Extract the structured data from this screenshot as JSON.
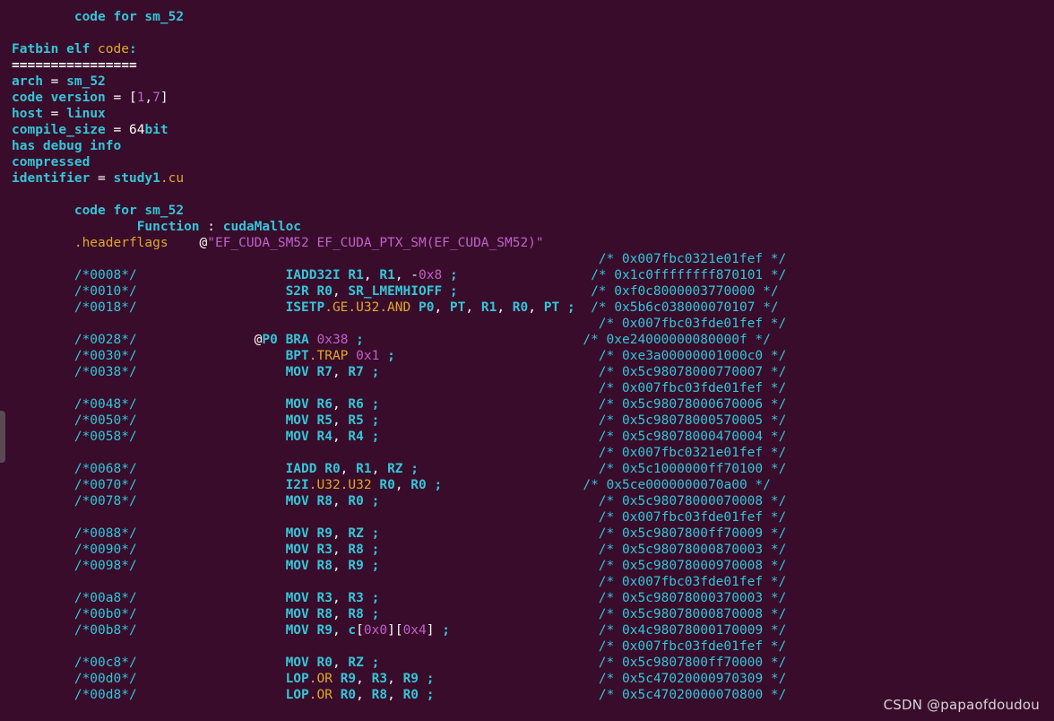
{
  "colors": {
    "background": "#380c2a",
    "keyword_cyan": "#34c6d8",
    "yellow": "#e0a829",
    "purple": "#c061cb",
    "white": "#ffffff"
  },
  "watermark": "CSDN @papaofdoudou",
  "terminal_lines": [
    [
      {
        "t": "        "
      },
      {
        "t": "code for sm_52",
        "c": "kw"
      }
    ],
    [],
    [
      {
        "t": "Fatbin elf ",
        "c": "kw"
      },
      {
        "t": "code",
        "c": "y"
      },
      {
        "t": ":",
        "c": "kw"
      }
    ],
    [
      {
        "t": "================",
        "c": "wb"
      }
    ],
    [
      {
        "t": "arch",
        "c": "kw"
      },
      {
        "t": " = "
      },
      {
        "t": "sm_52",
        "c": "kw"
      }
    ],
    [
      {
        "t": "code version",
        "c": "kw"
      },
      {
        "t": " = ["
      },
      {
        "t": "1",
        "c": "p"
      },
      {
        "t": ","
      },
      {
        "t": "7",
        "c": "p"
      },
      {
        "t": "]"
      }
    ],
    [
      {
        "t": "host",
        "c": "kw"
      },
      {
        "t": " = "
      },
      {
        "t": "linux",
        "c": "kw"
      }
    ],
    [
      {
        "t": "compile_size",
        "c": "kw"
      },
      {
        "t": " = "
      },
      {
        "t": "64"
      },
      {
        "t": "bit",
        "c": "kw"
      }
    ],
    [
      {
        "t": "has debug info",
        "c": "kw"
      }
    ],
    [
      {
        "t": "compressed",
        "c": "kw"
      }
    ],
    [
      {
        "t": "identifier",
        "c": "kw"
      },
      {
        "t": " = "
      },
      {
        "t": "study1",
        "c": "kw"
      },
      {
        "t": ".cu",
        "c": "y"
      }
    ],
    [],
    [
      {
        "t": "        "
      },
      {
        "t": "code for sm_52",
        "c": "kw"
      }
    ],
    [
      {
        "t": "                "
      },
      {
        "t": "Function",
        "c": "kw"
      },
      {
        "t": " : "
      },
      {
        "t": "cudaMalloc",
        "c": "kw"
      }
    ],
    [
      {
        "t": "        "
      },
      {
        "t": ".headerflags",
        "c": "y"
      },
      {
        "t": "    @"
      },
      {
        "t": "\"EF_CUDA_SM52 EF_CUDA_PTX_SM(EF_CUDA_SM52)\"",
        "c": "p"
      }
    ],
    [
      {
        "t": "                                                                           "
      },
      {
        "t": "/* 0x007fbc0321e01fef */",
        "c": "hex"
      }
    ],
    [
      {
        "t": "        "
      },
      {
        "t": "/*0008*/",
        "c": "cm"
      },
      {
        "t": "                   "
      },
      {
        "t": "IADD32I R1",
        "c": "kw"
      },
      {
        "t": ", "
      },
      {
        "t": "R1",
        "c": "kw"
      },
      {
        "t": ", -"
      },
      {
        "t": "0x8",
        "c": "p"
      },
      {
        "t": " ;",
        "c": "kw"
      },
      {
        "t": "                 "
      },
      {
        "t": "/* 0x1c0ffffffff870101 */",
        "c": "hex"
      }
    ],
    [
      {
        "t": "        "
      },
      {
        "t": "/*0010*/",
        "c": "cm"
      },
      {
        "t": "                   "
      },
      {
        "t": "S2R R0",
        "c": "kw"
      },
      {
        "t": ", "
      },
      {
        "t": "SR_LMEMHIOFF",
        "c": "kw"
      },
      {
        "t": " ;",
        "c": "kw"
      },
      {
        "t": "                 "
      },
      {
        "t": "/* 0xf0c8000003770000 */",
        "c": "hex"
      }
    ],
    [
      {
        "t": "        "
      },
      {
        "t": "/*0018*/",
        "c": "cm"
      },
      {
        "t": "                   "
      },
      {
        "t": "ISETP",
        "c": "kw"
      },
      {
        "t": ".GE.U32.AND",
        "c": "y"
      },
      {
        "t": " "
      },
      {
        "t": "P0",
        "c": "kw"
      },
      {
        "t": ", "
      },
      {
        "t": "PT",
        "c": "kw"
      },
      {
        "t": ", "
      },
      {
        "t": "R1",
        "c": "kw"
      },
      {
        "t": ", "
      },
      {
        "t": "R0",
        "c": "kw"
      },
      {
        "t": ", "
      },
      {
        "t": "PT",
        "c": "kw"
      },
      {
        "t": " ;",
        "c": "kw"
      },
      {
        "t": "  "
      },
      {
        "t": "/* 0x5b6c038000070107 */",
        "c": "hex"
      }
    ],
    [
      {
        "t": "                                                                           "
      },
      {
        "t": "/* 0x007fbc03fde01fef */",
        "c": "hex"
      }
    ],
    [
      {
        "t": "        "
      },
      {
        "t": "/*0028*/",
        "c": "cm"
      },
      {
        "t": "               @"
      },
      {
        "t": "P0",
        "c": "kw"
      },
      {
        "t": " "
      },
      {
        "t": "BRA",
        "c": "kw"
      },
      {
        "t": " "
      },
      {
        "t": "0x38",
        "c": "p"
      },
      {
        "t": " ;",
        "c": "kw"
      },
      {
        "t": "                            "
      },
      {
        "t": "/* 0xe24000000080000f */",
        "c": "hex"
      }
    ],
    [
      {
        "t": "        "
      },
      {
        "t": "/*0030*/",
        "c": "cm"
      },
      {
        "t": "                   "
      },
      {
        "t": "BPT",
        "c": "kw"
      },
      {
        "t": ".TRAP",
        "c": "y"
      },
      {
        "t": " "
      },
      {
        "t": "0x1",
        "c": "p"
      },
      {
        "t": " ;",
        "c": "kw"
      },
      {
        "t": "                          "
      },
      {
        "t": "/* 0xe3a00000001000c0 */",
        "c": "hex"
      }
    ],
    [
      {
        "t": "        "
      },
      {
        "t": "/*0038*/",
        "c": "cm"
      },
      {
        "t": "                   "
      },
      {
        "t": "MOV R7",
        "c": "kw"
      },
      {
        "t": ", "
      },
      {
        "t": "R7",
        "c": "kw"
      },
      {
        "t": " ;",
        "c": "kw"
      },
      {
        "t": "                            "
      },
      {
        "t": "/* 0x5c98078000770007 */",
        "c": "hex"
      }
    ],
    [
      {
        "t": "                                                                           "
      },
      {
        "t": "/* 0x007fbc03fde01fef */",
        "c": "hex"
      }
    ],
    [
      {
        "t": "        "
      },
      {
        "t": "/*0048*/",
        "c": "cm"
      },
      {
        "t": "                   "
      },
      {
        "t": "MOV R6",
        "c": "kw"
      },
      {
        "t": ", "
      },
      {
        "t": "R6",
        "c": "kw"
      },
      {
        "t": " ;",
        "c": "kw"
      },
      {
        "t": "                            "
      },
      {
        "t": "/* 0x5c98078000670006 */",
        "c": "hex"
      }
    ],
    [
      {
        "t": "        "
      },
      {
        "t": "/*0050*/",
        "c": "cm"
      },
      {
        "t": "                   "
      },
      {
        "t": "MOV R5",
        "c": "kw"
      },
      {
        "t": ", "
      },
      {
        "t": "R5",
        "c": "kw"
      },
      {
        "t": " ;",
        "c": "kw"
      },
      {
        "t": "                            "
      },
      {
        "t": "/* 0x5c98078000570005 */",
        "c": "hex"
      }
    ],
    [
      {
        "t": "        "
      },
      {
        "t": "/*0058*/",
        "c": "cm"
      },
      {
        "t": "                   "
      },
      {
        "t": "MOV R4",
        "c": "kw"
      },
      {
        "t": ", "
      },
      {
        "t": "R4",
        "c": "kw"
      },
      {
        "t": " ;",
        "c": "kw"
      },
      {
        "t": "                            "
      },
      {
        "t": "/* 0x5c98078000470004 */",
        "c": "hex"
      }
    ],
    [
      {
        "t": "                                                                           "
      },
      {
        "t": "/* 0x007fbc0321e01fef */",
        "c": "hex"
      }
    ],
    [
      {
        "t": "        "
      },
      {
        "t": "/*0068*/",
        "c": "cm"
      },
      {
        "t": "                   "
      },
      {
        "t": "IADD R0",
        "c": "kw"
      },
      {
        "t": ", "
      },
      {
        "t": "R1",
        "c": "kw"
      },
      {
        "t": ", "
      },
      {
        "t": "RZ",
        "c": "kw"
      },
      {
        "t": " ;",
        "c": "kw"
      },
      {
        "t": "                       "
      },
      {
        "t": "/* 0x5c1000000ff70100 */",
        "c": "hex"
      }
    ],
    [
      {
        "t": "        "
      },
      {
        "t": "/*0070*/",
        "c": "cm"
      },
      {
        "t": "                   "
      },
      {
        "t": "I2I",
        "c": "kw"
      },
      {
        "t": ".U32.U32",
        "c": "y"
      },
      {
        "t": " "
      },
      {
        "t": "R0",
        "c": "kw"
      },
      {
        "t": ", "
      },
      {
        "t": "R0",
        "c": "kw"
      },
      {
        "t": " ;",
        "c": "kw"
      },
      {
        "t": "                  "
      },
      {
        "t": "/* 0x5ce0000000070a00 */",
        "c": "hex"
      }
    ],
    [
      {
        "t": "        "
      },
      {
        "t": "/*0078*/",
        "c": "cm"
      },
      {
        "t": "                   "
      },
      {
        "t": "MOV R8",
        "c": "kw"
      },
      {
        "t": ", "
      },
      {
        "t": "R0",
        "c": "kw"
      },
      {
        "t": " ;",
        "c": "kw"
      },
      {
        "t": "                            "
      },
      {
        "t": "/* 0x5c98078000070008 */",
        "c": "hex"
      }
    ],
    [
      {
        "t": "                                                                           "
      },
      {
        "t": "/* 0x007fbc03fde01fef */",
        "c": "hex"
      }
    ],
    [
      {
        "t": "        "
      },
      {
        "t": "/*0088*/",
        "c": "cm"
      },
      {
        "t": "                   "
      },
      {
        "t": "MOV R9",
        "c": "kw"
      },
      {
        "t": ", "
      },
      {
        "t": "RZ",
        "c": "kw"
      },
      {
        "t": " ;",
        "c": "kw"
      },
      {
        "t": "                            "
      },
      {
        "t": "/* 0x5c9807800ff70009 */",
        "c": "hex"
      }
    ],
    [
      {
        "t": "        "
      },
      {
        "t": "/*0090*/",
        "c": "cm"
      },
      {
        "t": "                   "
      },
      {
        "t": "MOV R3",
        "c": "kw"
      },
      {
        "t": ", "
      },
      {
        "t": "R8",
        "c": "kw"
      },
      {
        "t": " ;",
        "c": "kw"
      },
      {
        "t": "                            "
      },
      {
        "t": "/* 0x5c98078000870003 */",
        "c": "hex"
      }
    ],
    [
      {
        "t": "        "
      },
      {
        "t": "/*0098*/",
        "c": "cm"
      },
      {
        "t": "                   "
      },
      {
        "t": "MOV R8",
        "c": "kw"
      },
      {
        "t": ", "
      },
      {
        "t": "R9",
        "c": "kw"
      },
      {
        "t": " ;",
        "c": "kw"
      },
      {
        "t": "                            "
      },
      {
        "t": "/* 0x5c98078000970008 */",
        "c": "hex"
      }
    ],
    [
      {
        "t": "                                                                           "
      },
      {
        "t": "/* 0x007fbc03fde01fef */",
        "c": "hex"
      }
    ],
    [
      {
        "t": "        "
      },
      {
        "t": "/*00a8*/",
        "c": "cm"
      },
      {
        "t": "                   "
      },
      {
        "t": "MOV R3",
        "c": "kw"
      },
      {
        "t": ", "
      },
      {
        "t": "R3",
        "c": "kw"
      },
      {
        "t": " ;",
        "c": "kw"
      },
      {
        "t": "                            "
      },
      {
        "t": "/* 0x5c98078000370003 */",
        "c": "hex"
      }
    ],
    [
      {
        "t": "        "
      },
      {
        "t": "/*00b0*/",
        "c": "cm"
      },
      {
        "t": "                   "
      },
      {
        "t": "MOV R8",
        "c": "kw"
      },
      {
        "t": ", "
      },
      {
        "t": "R8",
        "c": "kw"
      },
      {
        "t": " ;",
        "c": "kw"
      },
      {
        "t": "                            "
      },
      {
        "t": "/* 0x5c98078000870008 */",
        "c": "hex"
      }
    ],
    [
      {
        "t": "        "
      },
      {
        "t": "/*00b8*/",
        "c": "cm"
      },
      {
        "t": "                   "
      },
      {
        "t": "MOV R9",
        "c": "kw"
      },
      {
        "t": ", "
      },
      {
        "t": "c",
        "c": "kw"
      },
      {
        "t": "["
      },
      {
        "t": "0x0",
        "c": "p"
      },
      {
        "t": "]["
      },
      {
        "t": "0x4",
        "c": "p"
      },
      {
        "t": "]"
      },
      {
        "t": " ;",
        "c": "kw"
      },
      {
        "t": "                   "
      },
      {
        "t": "/* 0x4c98078000170009 */",
        "c": "hex"
      }
    ],
    [
      {
        "t": "                                                                           "
      },
      {
        "t": "/* 0x007fbc03fde01fef */",
        "c": "hex"
      }
    ],
    [
      {
        "t": "        "
      },
      {
        "t": "/*00c8*/",
        "c": "cm"
      },
      {
        "t": "                   "
      },
      {
        "t": "MOV R0",
        "c": "kw"
      },
      {
        "t": ", "
      },
      {
        "t": "RZ",
        "c": "kw"
      },
      {
        "t": " ;",
        "c": "kw"
      },
      {
        "t": "                            "
      },
      {
        "t": "/* 0x5c9807800ff70000 */",
        "c": "hex"
      }
    ],
    [
      {
        "t": "        "
      },
      {
        "t": "/*00d0*/",
        "c": "cm"
      },
      {
        "t": "                   "
      },
      {
        "t": "LOP",
        "c": "kw"
      },
      {
        "t": ".OR",
        "c": "y"
      },
      {
        "t": " "
      },
      {
        "t": "R9",
        "c": "kw"
      },
      {
        "t": ", "
      },
      {
        "t": "R3",
        "c": "kw"
      },
      {
        "t": ", "
      },
      {
        "t": "R9",
        "c": "kw"
      },
      {
        "t": " ;",
        "c": "kw"
      },
      {
        "t": "                     "
      },
      {
        "t": "/* 0x5c47020000970309 */",
        "c": "hex"
      }
    ],
    [
      {
        "t": "        "
      },
      {
        "t": "/*00d8*/",
        "c": "cm"
      },
      {
        "t": "                   "
      },
      {
        "t": "LOP",
        "c": "kw"
      },
      {
        "t": ".OR",
        "c": "y"
      },
      {
        "t": " "
      },
      {
        "t": "R0",
        "c": "kw"
      },
      {
        "t": ", "
      },
      {
        "t": "R8",
        "c": "kw"
      },
      {
        "t": ", "
      },
      {
        "t": "R0",
        "c": "kw"
      },
      {
        "t": " ;",
        "c": "kw"
      },
      {
        "t": "                     "
      },
      {
        "t": "/* 0x5c47020000070800 */",
        "c": "hex"
      }
    ]
  ]
}
